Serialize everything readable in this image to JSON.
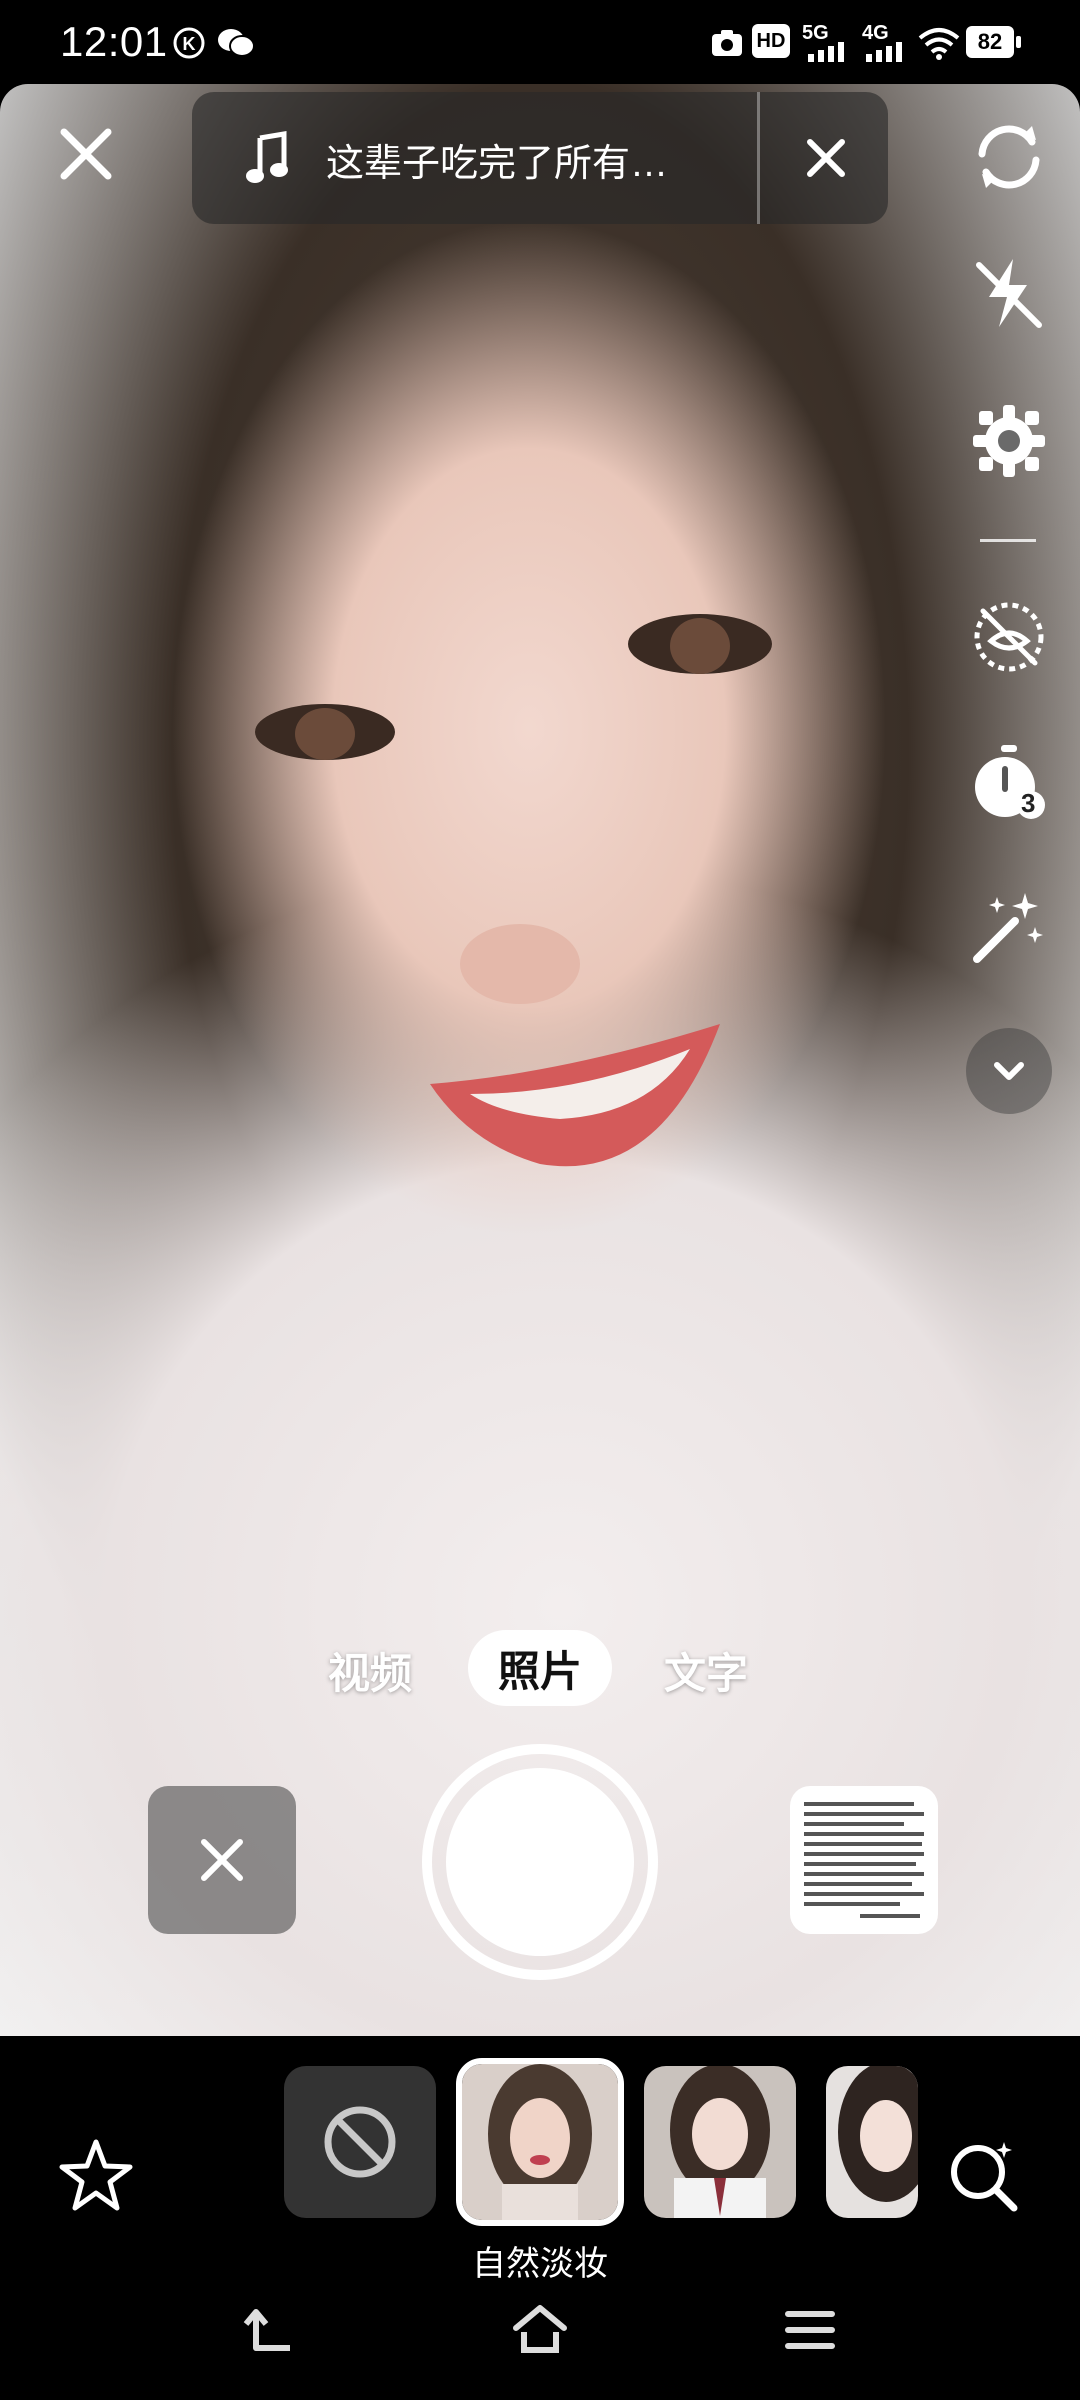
{
  "status_bar": {
    "time": "12:01",
    "hd_label": "HD",
    "network_5g": "5G",
    "network_4g": "4G",
    "battery": "82"
  },
  "top": {
    "music_title": "这辈子吃完了所有…"
  },
  "modes": {
    "video": "视频",
    "photo": "照片",
    "text": "文字"
  },
  "tools": {
    "timer_value": "3"
  },
  "filters": {
    "selected_label": "自然淡妆"
  },
  "colors": {
    "accent_white": "#ffffff",
    "pill_bg": "#282828"
  }
}
